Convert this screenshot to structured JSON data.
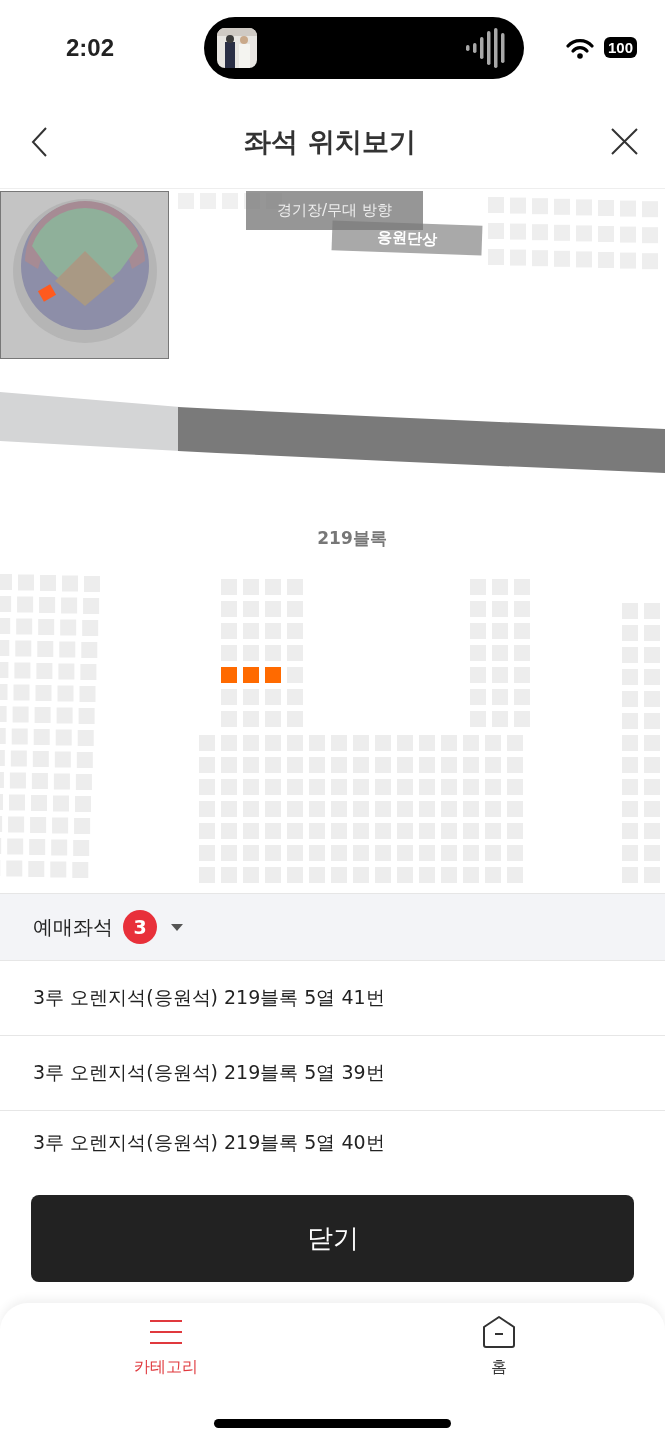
{
  "status_bar": {
    "time": "2:02",
    "battery": "100"
  },
  "header": {
    "title": "좌석 위치보기"
  },
  "seat_map": {
    "direction_label": "경기장/무대 방향",
    "stage_label": "응원단상",
    "block_label": "219블록",
    "highlighted_row": [
      {
        "selected": true
      },
      {
        "selected": true
      },
      {
        "selected": true
      },
      {
        "selected": false
      }
    ]
  },
  "booked_seats": {
    "label": "예매좌석",
    "count": "3",
    "items": [
      "3루 오렌지석(응원석) 219블록 5열 41번",
      "3루 오렌지석(응원석) 219블록 5열 39번",
      "3루 오렌지석(응원석) 219블록 5열 40번"
    ]
  },
  "close_button": "닫기",
  "tab_bar": [
    {
      "kind": "menu",
      "label": "카테고리",
      "selected": true
    },
    {
      "kind": "home",
      "label": "홈",
      "selected": false
    }
  ]
}
